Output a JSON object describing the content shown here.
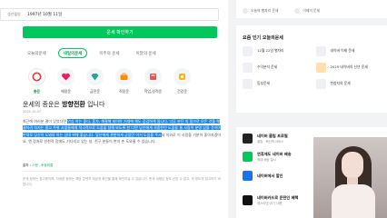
{
  "birth": {
    "label": "생년월일",
    "value": "1997년 10월 11일"
  },
  "fortune_button": "운세 확인하기",
  "tabs": [
    "오늘의운세",
    "내일의운세",
    "이주의 운세",
    "이달의 운세"
  ],
  "categories": [
    {
      "label": "총운",
      "icon": "circle-icon",
      "color": "#e53935"
    },
    {
      "label": "애정운",
      "icon": "heart-icon",
      "color": "#e91e63"
    },
    {
      "label": "금전운",
      "icon": "diamond-icon",
      "color": "#26a69a"
    },
    {
      "label": "직장운",
      "icon": "briefcase-icon",
      "color": "#fb8c00"
    },
    {
      "label": "학업,성적운",
      "icon": "book-icon",
      "color": "#ef5350"
    },
    {
      "label": "건강운",
      "icon": "health-icon",
      "color": "#ffb300"
    }
  ],
  "fortune": {
    "heading_prefix": "운세의 종운은 ",
    "heading_strong": "방향전환",
    "heading_suffix": " 입니다",
    "date": "2025.10.07",
    "body_before": "최근에 여러분 결이 있었다면 ",
    "body_highlight": "안심 하는 좋다, 혼자, 해결해 되어야 기대에 해도 갑갑하게 됩니다. 너무 분단 의 힘으로 모든 것을 해결하려 하지는 말고 주위 사람들에게 적극적으로 도움을 청해 보도록 한 다면 당신에게 귀중한인 도움을 줄 사람이 분명 있을 것이며 반대로 당신이 도와야 하는 상대 위해 좋습니다. 맞산에게 관한하게 굳었던 이거 도움을 주시",
    "body_after": "되 의외로 이 사람을 기분이 좋아지겠어요. 엔 정처로 선천적 장에도 기다리고 있는 날, 친구 분들이 변치 손 도와줄 수 있습니다.",
    "source_label": "출처 : ",
    "source_value": "스탠 - 토정비결",
    "disclaimer": "운세 정보는 참고용이며, 자세한 정보는 해당 콘텐츠 제공처 확인을 통해 확인하실 수 있습니다. 운세 내용은 정도 신빙 수 없고, 의 정도의 참고하기 바랍니다."
  },
  "top_links": [
    "오늘의 별자리 운세",
    "이제의 운세"
  ],
  "popular": {
    "title": "요즘 인기 오늘의운세",
    "items": [
      "12월 22일 별자리",
      "네이버 이제 운세",
      "수익분석 운세",
      "2025 네이버의 신년 운세",
      "동부운세",
      "천창지의 운세"
    ]
  },
  "news": [
    {
      "title": "네이버 클립 프로필",
      "sub": "클립 · 혁신적 서비스"
    },
    {
      "title": "연휴에도 네이버 배송",
      "sub": "최대 배송 일시"
    },
    {
      "title": "네이버에서 할인",
      "sub": ""
    },
    {
      "title": "네이버카드로 운전인 혜택",
      "sub": "제스티넷 여기 사용"
    }
  ]
}
